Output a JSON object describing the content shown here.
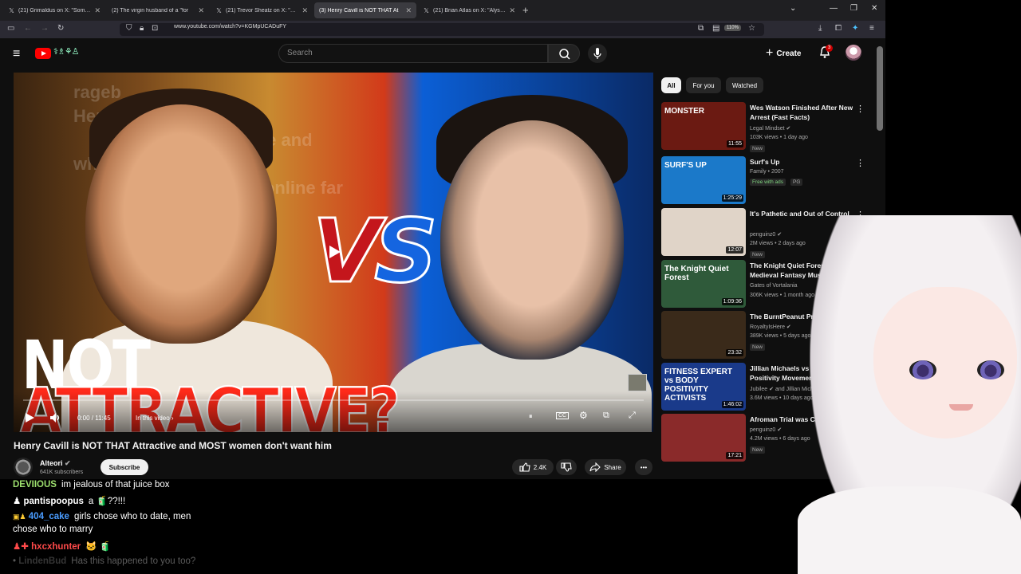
{
  "browser": {
    "tabs": [
      {
        "label": "(21) Grimaldus on X: \"Someon",
        "icon": "x-logo-icon",
        "active": false
      },
      {
        "label": "(2) The virgin husband of a \"for",
        "icon": "youtube-icon",
        "active": false
      },
      {
        "label": "(21) Trevor Sheatz on X: \"My wi",
        "icon": "x-logo-icon",
        "active": false
      },
      {
        "label": "(3) Henry Cavill is NOT THAT At",
        "icon": "youtube-icon",
        "active": true
      },
      {
        "label": "(21) Brian Atlas on X: \"Alysa Liu",
        "icon": "x-logo-icon",
        "active": false
      }
    ],
    "url": "www.youtube.com/watch?v=KGMpUCADuFY",
    "zoom": "110%"
  },
  "youtube": {
    "search_placeholder": "Search",
    "create_label": "Create",
    "notifications_count": "3",
    "filter_chips": [
      "All",
      "For you",
      "Watched"
    ]
  },
  "video": {
    "thumbnail_text_line1": "NOT",
    "thumbnail_text_line2": "ATTRACTIVE?",
    "thumbnail_vs": {
      "v": "V",
      "s": "S"
    },
    "blurred_post_text": [
      "rageb",
      "Henr",
      "vampire and",
      "wh",
      "port online far"
    ],
    "time": "0:00 / 11:45",
    "chapter_label": "In this video",
    "title": "Henry Cavill is NOT THAT Attractive and MOST women don't want him",
    "channel_name": "Alteori",
    "subscribers": "641K subscribers",
    "subscribe_label": "Subscribe",
    "likes": "2.4K",
    "share_label": "Share",
    "progress_fraction": 0
  },
  "recommendations": [
    {
      "title": "Wes Watson Finished After New Arrest (Fast Facts)",
      "channel": "Legal Mindset",
      "verified": true,
      "meta": "103K views • 1 day ago",
      "badge": "New",
      "duration": "11:55",
      "thumb_text": "MONSTER",
      "thumb_bg": "#6b1a12"
    },
    {
      "title": "Surf's Up",
      "channel": "Family • 2007",
      "verified": false,
      "meta": "",
      "badge": "Free with ads",
      "badge2": "PG",
      "duration": "1:25:29",
      "thumb_text": "SURF'S UP",
      "thumb_bg": "#1b79c9"
    },
    {
      "title": "It's Pathetic and Out of Control",
      "channel": "penguinz0",
      "verified": true,
      "meta": "2M views • 2 days ago",
      "badge": "New",
      "duration": "12:07",
      "thumb_text": "",
      "thumb_bg": "#e0d4c8"
    },
    {
      "title": "The Knight Quiet Forest | Medieval Fantasy Music for ...",
      "channel": "Gates of Vortalania",
      "verified": false,
      "meta": "306K views • 1 month ago",
      "badge": "",
      "duration": "1:09:36",
      "thumb_text": "The Knight Quiet Forest",
      "thumb_bg": "#2f5a3a"
    },
    {
      "title": "The BurntPeanut Problem",
      "channel": "RoyaltyIsHere",
      "verified": true,
      "meta": "389K views • 5 days ago",
      "badge": "New",
      "duration": "23:32",
      "thumb_text": "",
      "thumb_bg": "#3a2a1a"
    },
    {
      "title": "Jillian Michaels vs The Body Positivity Movement |",
      "channel": "Jubilee",
      "verified": true,
      "channel_extra": "and Jillian Michaels",
      "meta": "3.6M views • 10 days ago",
      "badge": "",
      "duration": "1:46:02",
      "thumb_text": "FITNESS EXPERT vs BODY POSITIVITY ACTIVISTS",
      "thumb_bg": "#1a3a8a"
    },
    {
      "title": "Afroman Trial was Crazy",
      "channel": "penguinz0",
      "verified": true,
      "meta": "4.2M views • 6 days ago",
      "badge": "New",
      "duration": "17:21",
      "thumb_text": "",
      "thumb_bg": "#8a2a2a"
    }
  ],
  "chat": [
    {
      "user": "DEVIIOUS",
      "color": "#9ddf6e",
      "message": "im jealous of that juice box",
      "prefix": ""
    },
    {
      "user": "pantispoopus",
      "color": "#ffffff",
      "message": "a 🧃??!!!",
      "prefix": "♟"
    },
    {
      "user": "404_cake",
      "color": "#4a9cff",
      "message": "girls chose who to date, men",
      "message2": "chose who to marry",
      "prefix": "▣♟"
    },
    {
      "user": "hxcxhunter",
      "color": "#ff4a4a",
      "message": "🐱 🧃",
      "prefix": "♟✚"
    },
    {
      "user": "LindenBud",
      "color": "#6a6a6a",
      "message": "Has this happened to you too?",
      "prefix": "•"
    }
  ],
  "colors": {
    "yt_bg": "#0f0f0f",
    "yt_red": "#ff0000",
    "chip_bg": "#272727",
    "tab_bar": "#1f1f22",
    "nav_bar": "#2b2a33"
  }
}
